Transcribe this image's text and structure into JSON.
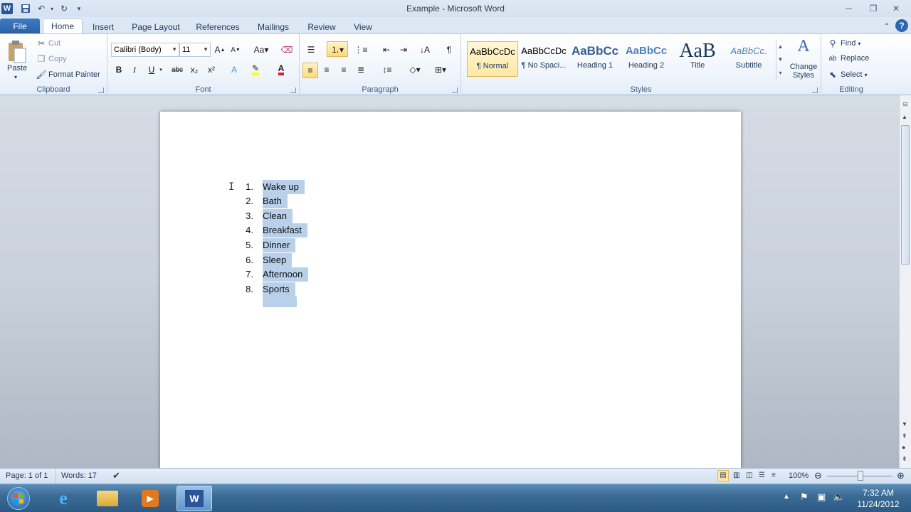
{
  "window": {
    "title": "Example - Microsoft Word"
  },
  "qat": {
    "word_logo": "W"
  },
  "tabs": [
    {
      "label": "File"
    },
    {
      "label": "Home"
    },
    {
      "label": "Insert"
    },
    {
      "label": "Page Layout"
    },
    {
      "label": "References"
    },
    {
      "label": "Mailings"
    },
    {
      "label": "Review"
    },
    {
      "label": "View"
    }
  ],
  "clipboard": {
    "paste": "Paste",
    "cut": "Cut",
    "copy": "Copy",
    "format_painter": "Format Painter",
    "group_label": "Clipboard"
  },
  "font": {
    "family": "Calibri (Body)",
    "size": "11",
    "group_label": "Font",
    "bold": "B",
    "italic": "I",
    "underline": "U",
    "strike": "abc",
    "subscript": "x₂",
    "superscript": "x²"
  },
  "paragraph": {
    "group_label": "Paragraph"
  },
  "styles": {
    "group_label": "Styles",
    "items": [
      {
        "sample": "AaBbCcDc",
        "name": "¶ Normal"
      },
      {
        "sample": "AaBbCcDc",
        "name": "¶ No Spaci..."
      },
      {
        "sample": "AaBbCc",
        "name": "Heading 1"
      },
      {
        "sample": "AaBbCc",
        "name": "Heading 2"
      },
      {
        "sample": "AaB",
        "name": "Title"
      },
      {
        "sample": "AaBbCc.",
        "name": "Subtitle"
      }
    ],
    "change_styles": "Change Styles"
  },
  "editing": {
    "group_label": "Editing",
    "find": "Find",
    "replace": "Replace",
    "select": "Select"
  },
  "document": {
    "list": [
      {
        "num": "1.",
        "text": "Wake up"
      },
      {
        "num": "2.",
        "text": "Bath"
      },
      {
        "num": "3.",
        "text": "Clean"
      },
      {
        "num": "4.",
        "text": "Breakfast"
      },
      {
        "num": "5.",
        "text": "Dinner"
      },
      {
        "num": "6.",
        "text": "Sleep"
      },
      {
        "num": "7.",
        "text": "Afternoon"
      },
      {
        "num": "8.",
        "text": "Sports"
      }
    ]
  },
  "status": {
    "page": "Page: 1 of 1",
    "words": "Words: 17",
    "zoom": "100%"
  },
  "taskbar": {
    "time": "7:32 AM",
    "date": "11/24/2012"
  },
  "colors": {
    "file_tab": "#2b5fa8",
    "selection": "#b8d0ea",
    "taskbar": "#3b6b96"
  }
}
